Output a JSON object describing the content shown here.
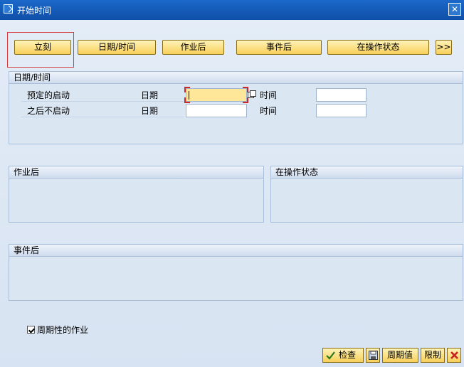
{
  "window": {
    "title": "开始时间",
    "icons": {
      "title": "schedule-edit-icon",
      "close": "close-icon"
    }
  },
  "toolbar": {
    "buttons": [
      {
        "label": "立刻"
      },
      {
        "label": "日期/时间"
      },
      {
        "label": "作业后"
      },
      {
        "label": "事件后"
      },
      {
        "label": "在操作状态"
      },
      {
        "label": ">>"
      }
    ]
  },
  "datetime_group": {
    "title": "日期/时间",
    "rows": [
      {
        "label": "预定的启动",
        "date_label": "日期",
        "date_value": "",
        "time_label": "时间",
        "time_value": ""
      },
      {
        "label": "之后不启动",
        "date_label": "日期",
        "date_value": "",
        "time_label": "时间",
        "time_value": ""
      }
    ]
  },
  "after_job_group": {
    "title": "作业后"
  },
  "op_state_group": {
    "title": "在操作状态"
  },
  "after_event_group": {
    "title": "事件后"
  },
  "periodic": {
    "label": "周期性的作业",
    "checked": true
  },
  "footer": {
    "buttons": [
      {
        "label": "检查",
        "icon": "check-icon"
      },
      {
        "label": "",
        "icon": "save-icon"
      },
      {
        "label": "周期值",
        "icon": ""
      },
      {
        "label": "限制",
        "icon": ""
      },
      {
        "label": "",
        "icon": "cancel-icon"
      }
    ]
  },
  "colors": {
    "titlebar": "#1b68c9",
    "button": "#f7d05a",
    "active_field": "#ffe79a",
    "focus": "#d63b3b"
  }
}
